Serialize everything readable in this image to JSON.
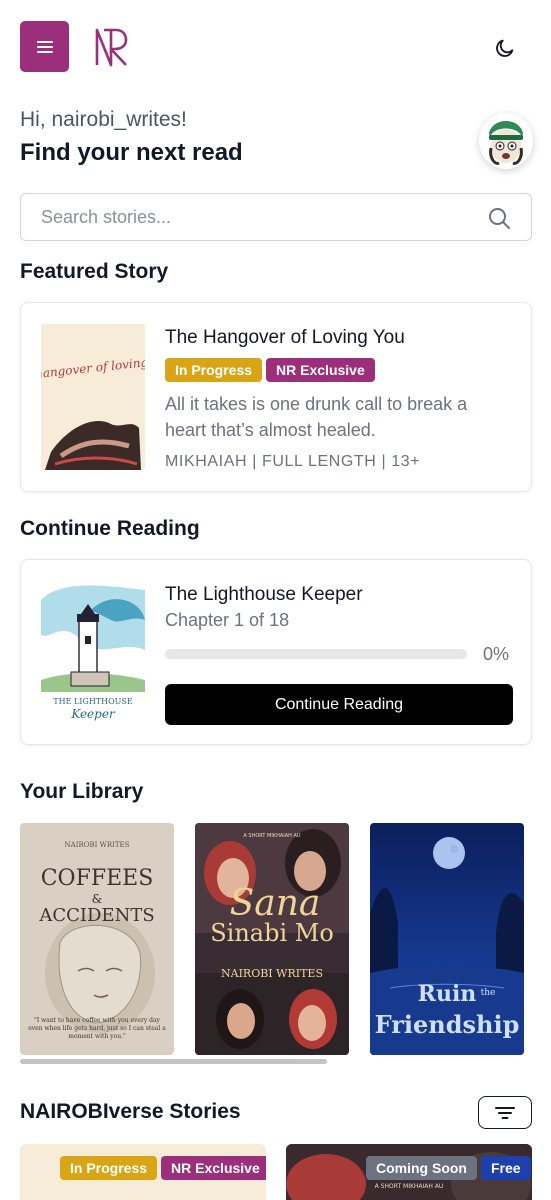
{
  "header": {
    "menu_icon": "hamburger-menu-icon",
    "logo_text": "NR",
    "theme_icon": "moon-icon",
    "accent_color": "#9b2f7c"
  },
  "greeting": {
    "hello": "Hi, nairobi_writes!",
    "headline": "Find your next read"
  },
  "search": {
    "placeholder": "Search stories...",
    "icon": "search-icon"
  },
  "featured": {
    "section_title": "Featured Story",
    "cover_text": "the hangover of loving you",
    "title": "The Hangover of Loving You",
    "badges": [
      "In Progress",
      "NR Exclusive"
    ],
    "blurb": "All it takes is one drunk call to break a heart that’s almost healed.",
    "meta": "MIKHAIAH | FULL LENGTH | 13+"
  },
  "continue_reading": {
    "section_title": "Continue Reading",
    "cover_text": "THE LIGHTHOUSE Keeper",
    "title": "The Lighthouse Keeper",
    "chapter": "Chapter 1 of 18",
    "progress": 0,
    "progress_label": "0%",
    "button_label": "Continue Reading"
  },
  "library": {
    "section_title": "Your Library",
    "items": [
      {
        "author": "NAIROBI WRITES",
        "title_line1": "COFFEES",
        "title_amp": "&",
        "title_line2": "ACCIDENTS",
        "quote": "\"I want to have coffee with you every day even when life gets hard, just so I can steal a moment with you.\""
      },
      {
        "top": "A SHORT MIKHAIAH AU",
        "title_line1": "Sana",
        "title_line2": "Sinabi Mo",
        "author": "NAIROBI WRITES"
      },
      {
        "title_line1": "Ruin",
        "title_the": "the",
        "title_line2": "Friendship"
      }
    ]
  },
  "nairobiverse": {
    "section_title": "NAIROBIverse Stories",
    "filter_icon": "filter-icon",
    "items": [
      {
        "badges": [
          "In Progress",
          "NR Exclusive"
        ]
      },
      {
        "badges": [
          "Coming Soon",
          "Free"
        ],
        "top": "A SHORT MIKHAIAH AU"
      }
    ]
  }
}
